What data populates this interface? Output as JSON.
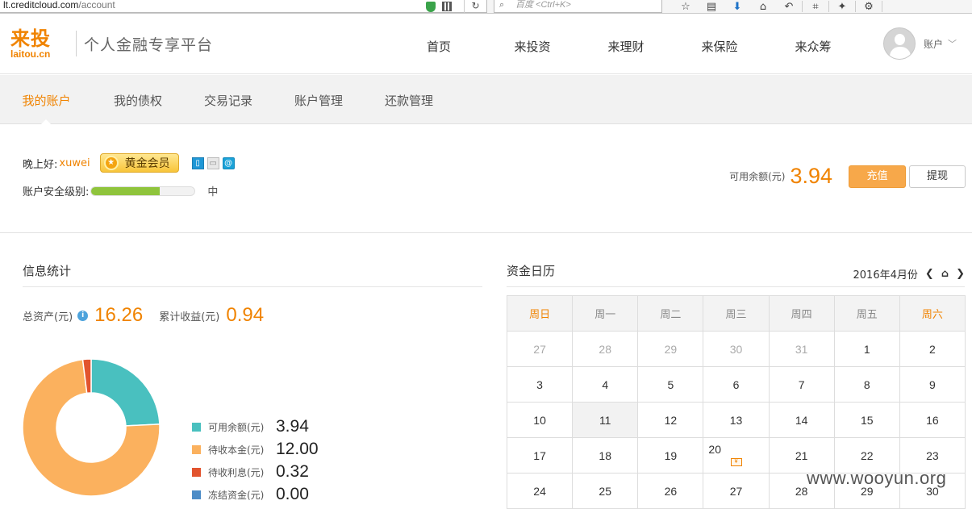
{
  "browser": {
    "url_host": "lt.creditcloud.com",
    "url_path": "/account",
    "search_placeholder": "百度 <Ctrl+K>"
  },
  "header": {
    "logo_cn": "来投",
    "logo_en": "laitou.cn",
    "slogan": "个人金融专享平台",
    "nav": [
      "首页",
      "来投资",
      "来理财",
      "来保险",
      "来众筹"
    ],
    "account_label": "账户"
  },
  "subnav": {
    "tabs": [
      "我的账户",
      "我的债权",
      "交易记录",
      "账户管理",
      "还款管理"
    ],
    "active_index": 0
  },
  "user": {
    "greeting": "晚上好:",
    "username": "xuwei",
    "member_badge": "黄金会员",
    "security_label": "账户安全级别:",
    "security_level": "中",
    "security_fraction": 0.66,
    "balance_label": "可用余额(元)",
    "balance_value": "3.94",
    "recharge_label": "充值",
    "withdraw_label": "提现"
  },
  "info": {
    "title": "信息统计",
    "total_assets_label": "总资产(元)",
    "total_assets_value": "16.26",
    "total_income_label": "累计收益(元)",
    "total_income_value": "0.94",
    "legend": [
      {
        "label": "可用余额(元)",
        "value": "3.94",
        "color": "#49c0bf"
      },
      {
        "label": "待收本金(元)",
        "value": "12.00",
        "color": "#fbb15e"
      },
      {
        "label": "待收利息(元)",
        "value": "0.32",
        "color": "#e2542e"
      },
      {
        "label": "冻结资金(元)",
        "value": "0.00",
        "color": "#4c8cc7"
      }
    ]
  },
  "calendar": {
    "title": "资金日历",
    "month_label": "2016年4月份",
    "weekdays": [
      "周日",
      "周一",
      "周二",
      "周三",
      "周四",
      "周五",
      "周六"
    ],
    "weeks": [
      [
        "27",
        "28",
        "29",
        "30",
        "31",
        "1",
        "2"
      ],
      [
        "3",
        "4",
        "5",
        "6",
        "7",
        "8",
        "9"
      ],
      [
        "10",
        "11",
        "12",
        "13",
        "14",
        "15",
        "16"
      ],
      [
        "17",
        "18",
        "19",
        "20",
        "21",
        "22",
        "23"
      ],
      [
        "24",
        "25",
        "26",
        "27",
        "28",
        "29",
        "30"
      ]
    ],
    "today": "11",
    "event_day": "20"
  },
  "watermark": "www.wooyun.org"
}
